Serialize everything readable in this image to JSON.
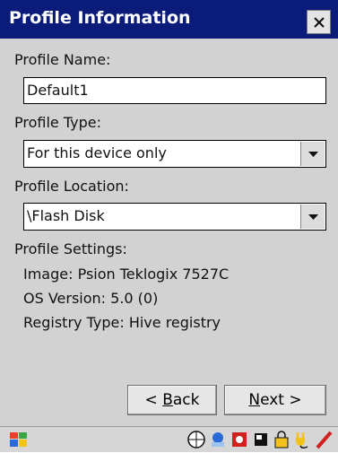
{
  "window": {
    "title": "Profile Information",
    "close_glyph": "×"
  },
  "form": {
    "profile_name_label": "Profile Name:",
    "profile_name_value": "Default1",
    "profile_type_label": "Profile Type:",
    "profile_type_value": "For this device only",
    "profile_location_label": "Profile Location:",
    "profile_location_value": "\\Flash Disk",
    "profile_settings_label": "Profile Settings:",
    "image_text": "Image: Psion Teklogix 7527C",
    "os_version_text": "OS Version: 5.0 (0)",
    "registry_type_text": "Registry Type: Hive registry"
  },
  "buttons": {
    "back_prefix": "< ",
    "back_mnemonic": "B",
    "back_rest": "ack",
    "next_mnemonic": "N",
    "next_rest": "ext >"
  },
  "taskbar": {
    "icons": [
      "start-icon",
      "keyboard-icon",
      "connection-icon",
      "settings-icon",
      "battery-icon",
      "lock-icon",
      "plug-icon",
      "pen-icon"
    ]
  },
  "colors": {
    "titlebar": "#0a1b7a",
    "content_bg": "#d2d2d2",
    "accent_red": "#d02020"
  }
}
